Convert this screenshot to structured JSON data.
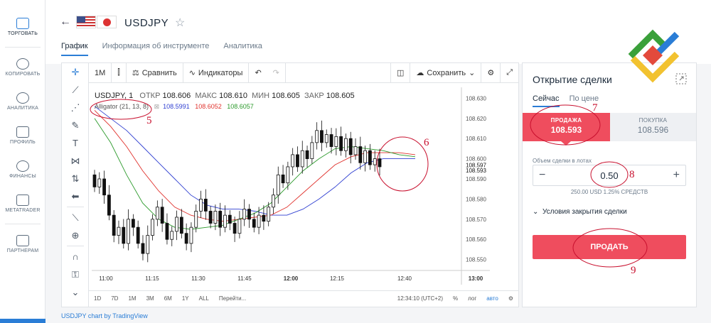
{
  "sidebar": {
    "items": [
      {
        "label": "ТОРГОВАТЬ",
        "icon": "chart-icon"
      },
      {
        "label": "КОПИРОВАТЬ",
        "icon": "user-icon"
      },
      {
        "label": "АНАЛИТИКА",
        "icon": "search-icon"
      },
      {
        "label": "ПРОФИЛЬ",
        "icon": "id-card-icon"
      },
      {
        "label": "ФИНАНСЫ",
        "icon": "dollar-icon"
      },
      {
        "label": "METATRADER",
        "icon": "monitor-icon"
      },
      {
        "label": "ПАРТНЕРАМ",
        "icon": "handshake-icon"
      }
    ]
  },
  "header": {
    "back": "←",
    "pair": "USDJPY",
    "star": "☆",
    "tabs": [
      "График",
      "Информация об инструменте",
      "Аналитика"
    ]
  },
  "chart_toolbar": {
    "interval": "1М",
    "compare": "Сравнить",
    "indicators": "Индикаторы",
    "save": "Сохранить"
  },
  "legend": {
    "symbol": "USDJPY, 1",
    "open_l": "ОТКР",
    "open": "108.606",
    "high_l": "МАКС",
    "high": "108.610",
    "low_l": "МИН",
    "low": "108.605",
    "close_l": "ЗАКР",
    "close": "108.605",
    "alligator": "Alligator (21, 13, 8)",
    "jaw": "108.5991",
    "teeth": "108.6052",
    "lips": "108.6057"
  },
  "bottom_bar": {
    "ranges": [
      "1D",
      "7D",
      "1M",
      "3M",
      "6M",
      "1Y",
      "ALL",
      "Перейти..."
    ],
    "time": "12:34:10 (UTC+2)",
    "pct": "%",
    "log": "лог",
    "auto": "авто"
  },
  "credit": "USDJPY chart by TradingView",
  "panel": {
    "title": "Открытие сделки",
    "tabs": [
      "Сейчас",
      "По цене"
    ],
    "sell_label": "ПРОДАЖА",
    "sell_price": "108.593",
    "buy_label": "ПОКУПКА",
    "buy_price": "108.596",
    "volume_label": "Объем сделки в лотах",
    "volume": "0.50",
    "volume_sub": "250.00 USD   1.25% СРЕДСТВ",
    "close_conditions": "Условия закрытия сделки",
    "sell_button": "ПРОДАТЬ"
  },
  "annotations": [
    "5",
    "6",
    "7",
    "8",
    "9"
  ],
  "colors": {
    "accent": "#2a7dd6",
    "sell": "#ef4d5e",
    "jaw": "#2f3fd1",
    "teeth": "#e0312c",
    "lips": "#2c9a2c"
  },
  "chart_data": {
    "type": "candlestick",
    "title": "USDJPY, 1",
    "x_ticks": [
      "11:00",
      "11:15",
      "11:30",
      "11:45",
      "12:00",
      "12:15",
      "12:40",
      "13:00"
    ],
    "y_ticks": [
      "108.630",
      "108.620",
      "108.610",
      "108.600",
      "108.590",
      "108.580",
      "108.570",
      "108.560",
      "108.550"
    ],
    "ylim": [
      108.546,
      108.634
    ],
    "last_price_label": "108.593",
    "prev_label": "108.597",
    "candles": [
      [
        108.592,
        108.586
      ],
      [
        108.586,
        108.59
      ],
      [
        108.59,
        108.582
      ],
      [
        108.582,
        108.572
      ],
      [
        108.572,
        108.562
      ],
      [
        108.562,
        108.566
      ],
      [
        108.566,
        108.558
      ],
      [
        108.558,
        108.57
      ],
      [
        108.57,
        108.566
      ],
      [
        108.566,
        108.558
      ],
      [
        108.558,
        108.553
      ],
      [
        108.553,
        108.562
      ],
      [
        108.562,
        108.57
      ],
      [
        108.57,
        108.576
      ],
      [
        108.576,
        108.568
      ],
      [
        108.568,
        108.56
      ],
      [
        108.56,
        108.564
      ],
      [
        108.564,
        108.571
      ],
      [
        108.571,
        108.563
      ],
      [
        108.563,
        108.558
      ],
      [
        108.558,
        108.566
      ],
      [
        108.566,
        108.574
      ],
      [
        108.574,
        108.58
      ],
      [
        108.58,
        108.574
      ],
      [
        108.574,
        108.568
      ],
      [
        108.568,
        108.574
      ],
      [
        108.574,
        108.566
      ],
      [
        108.566,
        108.572
      ],
      [
        108.572,
        108.568
      ],
      [
        108.568,
        108.563
      ],
      [
        108.563,
        108.57
      ],
      [
        108.57,
        108.575
      ],
      [
        108.575,
        108.57
      ],
      [
        108.57,
        108.566
      ],
      [
        108.566,
        108.572
      ],
      [
        108.572,
        108.569
      ],
      [
        108.569,
        108.576
      ],
      [
        108.576,
        108.582
      ],
      [
        108.582,
        108.592
      ],
      [
        108.592,
        108.588
      ],
      [
        108.588,
        108.596
      ],
      [
        108.596,
        108.602
      ],
      [
        108.602,
        108.596
      ],
      [
        108.596,
        108.604
      ],
      [
        108.604,
        108.6
      ],
      [
        108.6,
        108.608
      ],
      [
        108.608,
        108.614
      ],
      [
        108.614,
        108.608
      ],
      [
        108.608,
        108.612
      ],
      [
        108.612,
        108.606
      ],
      [
        108.606,
        108.611
      ],
      [
        108.611,
        108.604
      ],
      [
        108.604,
        108.61
      ],
      [
        108.61,
        108.602
      ],
      [
        108.602,
        108.606
      ],
      [
        108.606,
        108.598
      ],
      [
        108.598,
        108.604
      ],
      [
        108.604,
        108.597
      ],
      [
        108.597,
        108.6
      ],
      [
        108.6,
        108.596
      ]
    ],
    "series": [
      {
        "name": "Jaw",
        "values": [
          108.626,
          108.62,
          108.614,
          108.606,
          108.598,
          108.59,
          108.582,
          108.577,
          108.575,
          108.575,
          108.574,
          108.572,
          108.572,
          108.575,
          108.58,
          108.586,
          108.593,
          108.598,
          108.6,
          108.6,
          108.6
        ]
      },
      {
        "name": "Teeth",
        "values": [
          108.624,
          108.616,
          108.606,
          108.594,
          108.584,
          108.576,
          108.572,
          108.57,
          108.569,
          108.57,
          108.571,
          108.572,
          108.576,
          108.583,
          108.59,
          108.597,
          108.601,
          108.603,
          108.603,
          108.603,
          108.602
        ]
      },
      {
        "name": "Lips",
        "values": [
          108.62,
          108.608,
          108.592,
          108.578,
          108.57,
          108.566,
          108.565,
          108.566,
          108.567,
          108.57,
          108.573,
          108.578,
          108.586,
          108.594,
          108.6,
          108.605,
          108.606,
          108.605,
          108.604,
          108.602,
          108.601
        ]
      }
    ]
  }
}
